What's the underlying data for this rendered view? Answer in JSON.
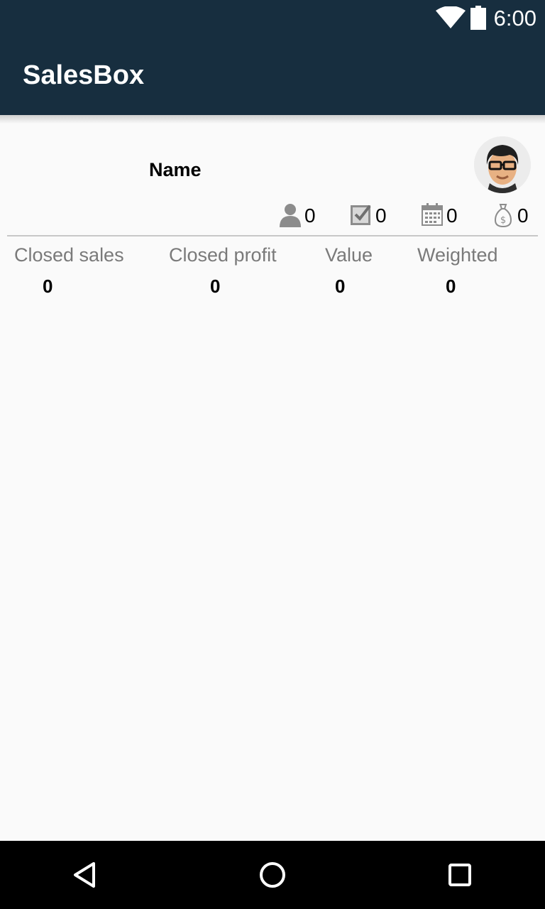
{
  "status_bar": {
    "time": "6:00",
    "icons": [
      "wifi-icon",
      "battery-icon"
    ]
  },
  "app_bar": {
    "title": "SalesBox"
  },
  "profile": {
    "name": "Name",
    "avatar_icon": "avatar-icon"
  },
  "stats": [
    {
      "icon": "person-icon",
      "count": "0"
    },
    {
      "icon": "task-check-icon",
      "count": "0"
    },
    {
      "icon": "calendar-icon",
      "count": "0"
    },
    {
      "icon": "money-bag-icon",
      "count": "0"
    }
  ],
  "metrics": [
    {
      "label": "Closed sales",
      "value": "0"
    },
    {
      "label": "Closed profit",
      "value": "0"
    },
    {
      "label": "Value",
      "value": "0"
    },
    {
      "label": "Weighted",
      "value": "0"
    }
  ],
  "nav_bar": {
    "buttons": [
      "back-icon",
      "home-icon",
      "recents-icon"
    ]
  },
  "colors": {
    "app_bar": "#172e3f",
    "background": "#fafafa",
    "label_gray": "#7a7a7a"
  }
}
